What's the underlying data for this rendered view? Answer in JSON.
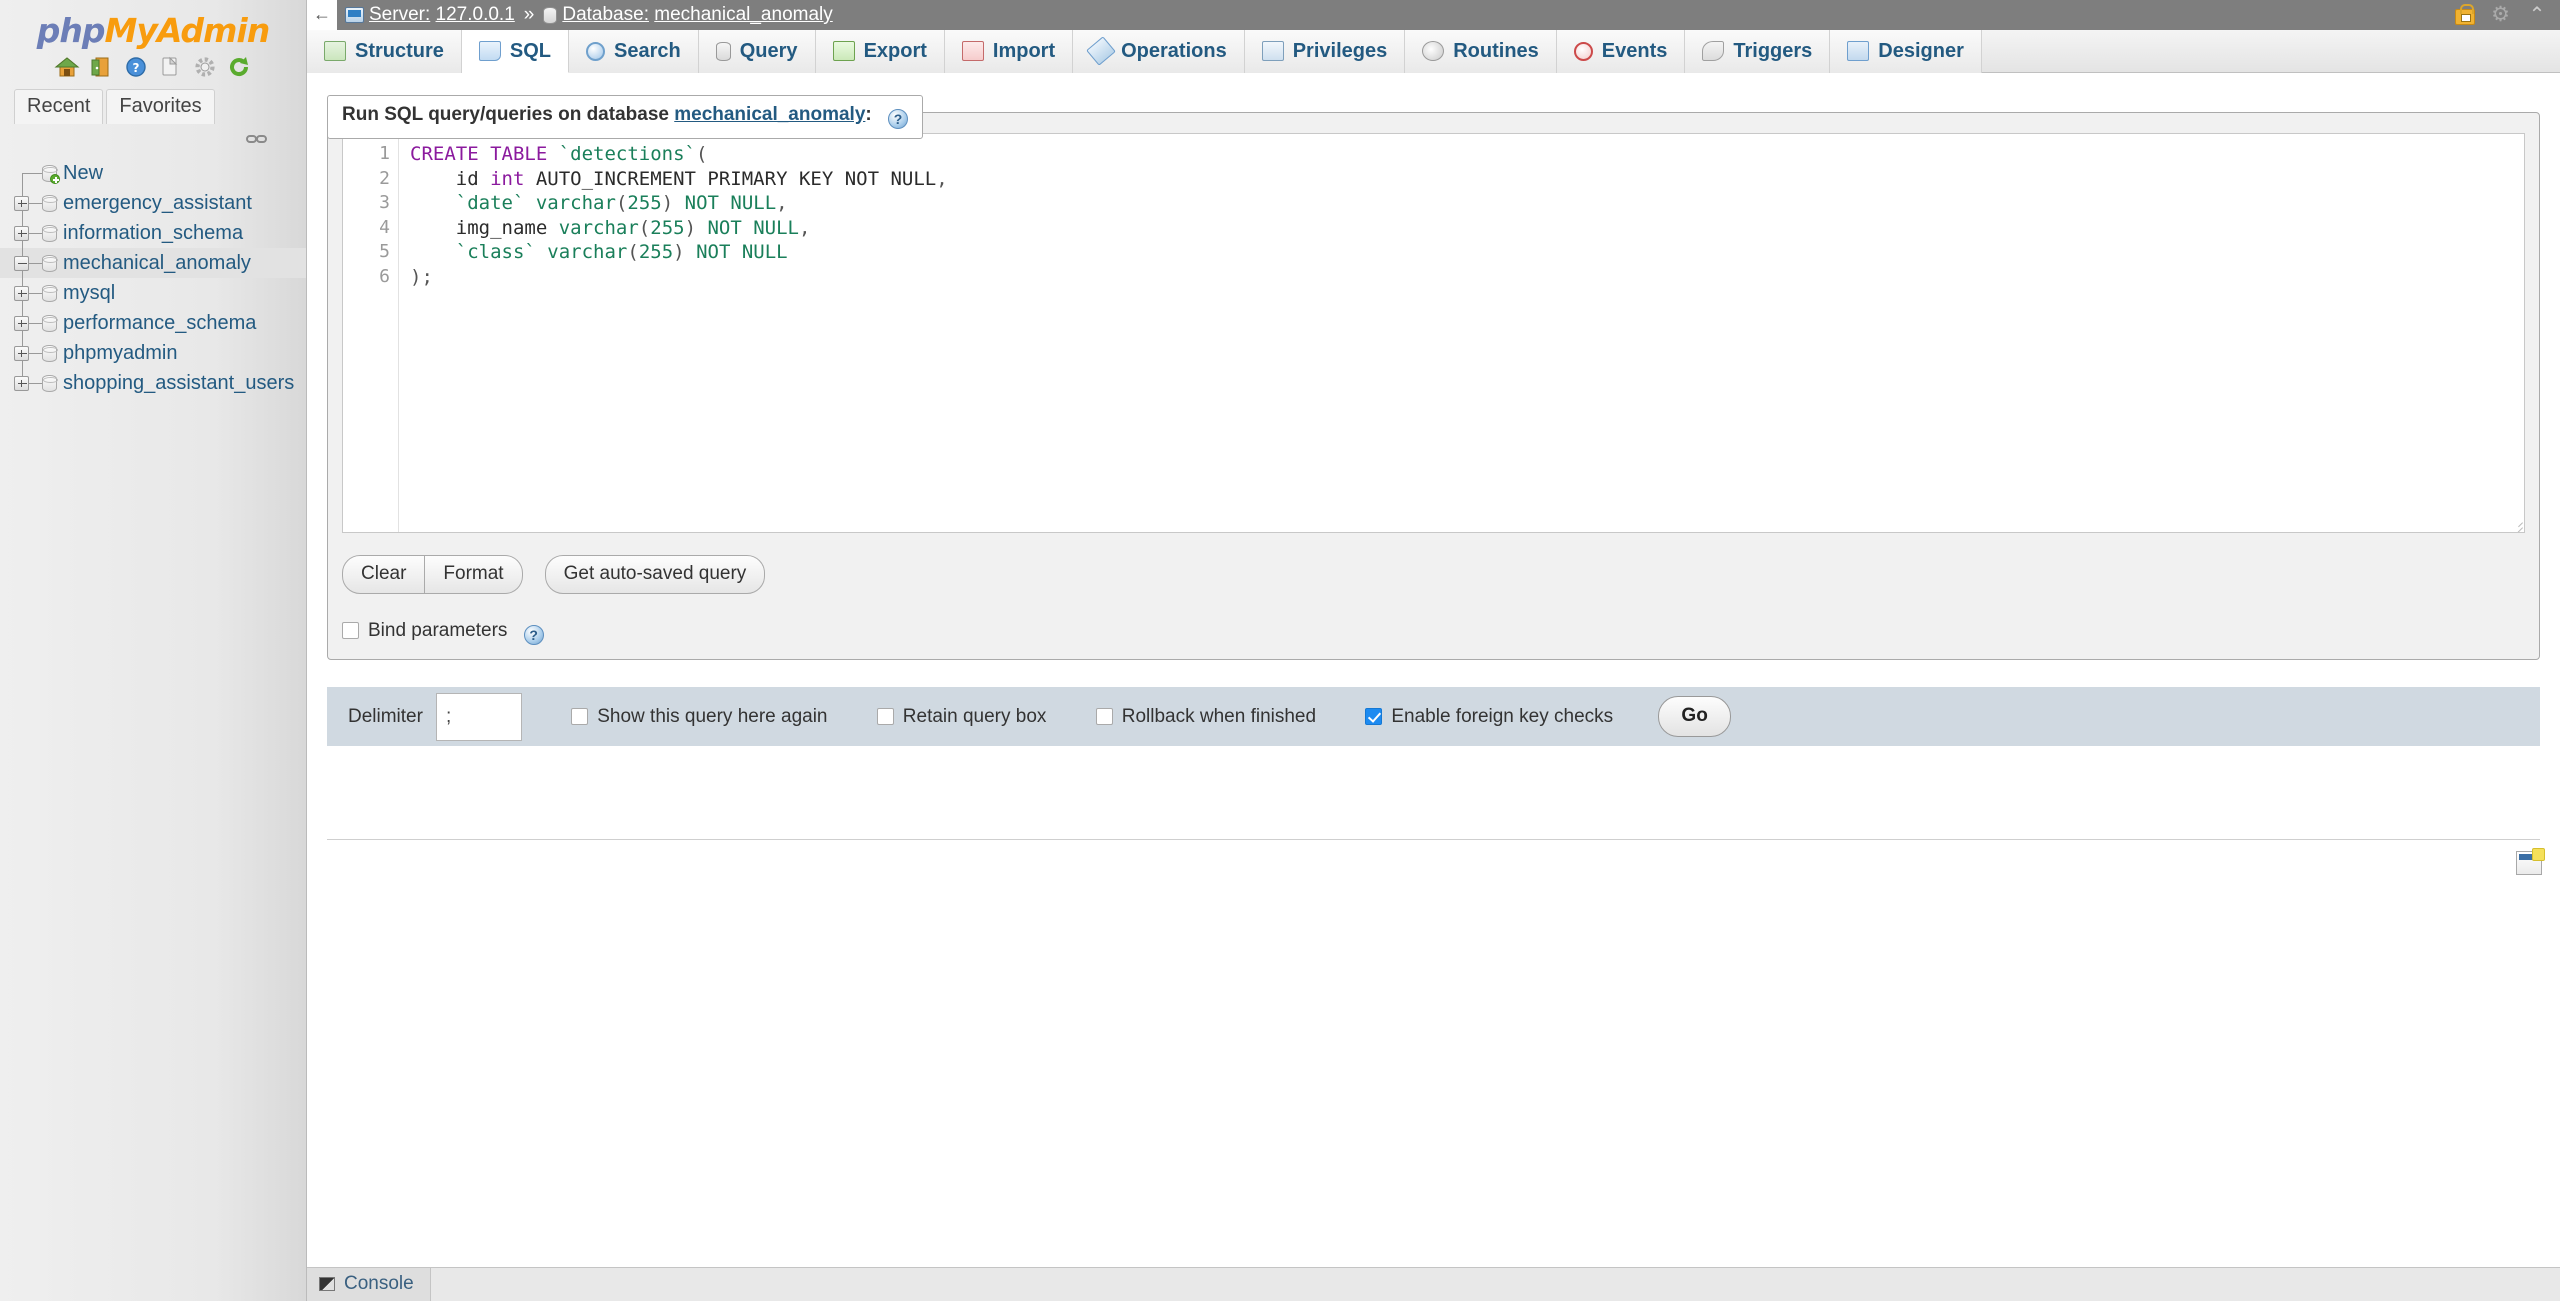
{
  "app": {
    "logo_php": "php",
    "logo_my": "My",
    "logo_admin": "Admin"
  },
  "navpanel": {
    "icons": [
      {
        "name": "home-icon"
      },
      {
        "name": "logout-icon"
      },
      {
        "name": "documentation-icon"
      },
      {
        "name": "copy-icon"
      },
      {
        "name": "settings-icon"
      },
      {
        "name": "reload-icon"
      }
    ],
    "tabs": [
      {
        "label": "Recent",
        "name": "nav-tab-recent"
      },
      {
        "label": "Favorites",
        "name": "nav-tab-favorites"
      }
    ],
    "chain_icon": "unlink-icon",
    "tree": [
      {
        "label": "New",
        "expander": "none",
        "selected": false,
        "new": true
      },
      {
        "label": "emergency_assistant",
        "expander": "plus",
        "selected": false
      },
      {
        "label": "information_schema",
        "expander": "plus",
        "selected": false
      },
      {
        "label": "mechanical_anomaly",
        "expander": "minus",
        "selected": true
      },
      {
        "label": "mysql",
        "expander": "plus",
        "selected": false
      },
      {
        "label": "performance_schema",
        "expander": "plus",
        "selected": false
      },
      {
        "label": "phpmyadmin",
        "expander": "plus",
        "selected": false
      },
      {
        "label": "shopping_assistant_users",
        "expander": "plus",
        "selected": false
      }
    ]
  },
  "topbar": {
    "back_arrow": "←",
    "server_label": "Server:",
    "server_value": "127.0.0.1",
    "separator": "»",
    "database_label": "Database:",
    "database_value": "mechanical_anomaly",
    "icons": [
      {
        "name": "lock-icon"
      },
      {
        "name": "gear-icon",
        "glyph": "⚙"
      },
      {
        "name": "collapse-icon",
        "glyph": "⌃"
      }
    ]
  },
  "tabs": [
    {
      "label": "Structure",
      "icon": "structure-icon",
      "cls": "ic-structure",
      "active": false
    },
    {
      "label": "SQL",
      "icon": "sql-icon",
      "cls": "ic-sql",
      "active": true
    },
    {
      "label": "Search",
      "icon": "search-icon",
      "cls": "ic-search",
      "active": false
    },
    {
      "label": "Query",
      "icon": "query-icon",
      "cls": "ic-query",
      "active": false
    },
    {
      "label": "Export",
      "icon": "export-icon",
      "cls": "ic-export",
      "active": false
    },
    {
      "label": "Import",
      "icon": "import-icon",
      "cls": "ic-import",
      "active": false
    },
    {
      "label": "Operations",
      "icon": "operations-icon",
      "cls": "ic-operations",
      "active": false
    },
    {
      "label": "Privileges",
      "icon": "privileges-icon",
      "cls": "ic-privileges",
      "active": false
    },
    {
      "label": "Routines",
      "icon": "routines-icon",
      "cls": "ic-routines",
      "active": false
    },
    {
      "label": "Events",
      "icon": "events-icon",
      "cls": "ic-events",
      "active": false
    },
    {
      "label": "Triggers",
      "icon": "triggers-icon",
      "cls": "ic-triggers",
      "active": false
    },
    {
      "label": "Designer",
      "icon": "designer-icon",
      "cls": "ic-designer",
      "active": false
    }
  ],
  "sql_form": {
    "legend_prefix": "Run SQL query/queries on database",
    "legend_db": "mechanical_anomaly",
    "legend_suffix": ":",
    "help_glyph": "?",
    "line_numbers": [
      "1",
      "2",
      "3",
      "4",
      "5",
      "6"
    ],
    "query_text": "CREATE TABLE `detections`(\n    id int AUTO_INCREMENT PRIMARY KEY NOT NULL,\n    `date` varchar(255) NOT NULL,\n    img_name varchar(255) NOT NULL,\n    `class` varchar(255) NOT NULL\n);",
    "query_lines": [
      [
        {
          "t": "CREATE TABLE ",
          "c": "tk-kw"
        },
        {
          "t": "`detections`",
          "c": "tk-ident"
        },
        {
          "t": "(",
          "c": "tk-punct"
        }
      ],
      [
        {
          "t": "    id ",
          "c": "tk-plain"
        },
        {
          "t": "int",
          "c": "tk-kw"
        },
        {
          "t": " AUTO_INCREMENT PRIMARY KEY NOT NULL",
          "c": "tk-plain"
        },
        {
          "t": ",",
          "c": "tk-punct"
        }
      ],
      [
        {
          "t": "    ",
          "c": "tk-plain"
        },
        {
          "t": "`date`",
          "c": "tk-ident"
        },
        {
          "t": " ",
          "c": "tk-plain"
        },
        {
          "t": "varchar",
          "c": "tk-type"
        },
        {
          "t": "(",
          "c": "tk-punct"
        },
        {
          "t": "255",
          "c": "tk-num"
        },
        {
          "t": ")",
          "c": "tk-punct"
        },
        {
          "t": " ",
          "c": "tk-plain"
        },
        {
          "t": "NOT NULL",
          "c": "tk-type"
        },
        {
          "t": ",",
          "c": "tk-punct"
        }
      ],
      [
        {
          "t": "    img_name ",
          "c": "tk-plain"
        },
        {
          "t": "varchar",
          "c": "tk-type"
        },
        {
          "t": "(",
          "c": "tk-punct"
        },
        {
          "t": "255",
          "c": "tk-num"
        },
        {
          "t": ")",
          "c": "tk-punct"
        },
        {
          "t": " ",
          "c": "tk-plain"
        },
        {
          "t": "NOT NULL",
          "c": "tk-type"
        },
        {
          "t": ",",
          "c": "tk-punct"
        }
      ],
      [
        {
          "t": "    ",
          "c": "tk-plain"
        },
        {
          "t": "`class`",
          "c": "tk-ident"
        },
        {
          "t": " ",
          "c": "tk-plain"
        },
        {
          "t": "varchar",
          "c": "tk-type"
        },
        {
          "t": "(",
          "c": "tk-punct"
        },
        {
          "t": "255",
          "c": "tk-num"
        },
        {
          "t": ")",
          "c": "tk-punct"
        },
        {
          "t": " ",
          "c": "tk-plain"
        },
        {
          "t": "NOT NULL",
          "c": "tk-type"
        }
      ],
      [
        {
          "t": ");",
          "c": "tk-punct"
        }
      ]
    ],
    "buttons": {
      "clear": "Clear",
      "format": "Format",
      "get_auto_saved": "Get auto-saved query"
    },
    "bind_parameters": {
      "label": "Bind parameters",
      "checked": false
    }
  },
  "footer": {
    "delimiter_label": "Delimiter",
    "delimiter_value": ";",
    "options": [
      {
        "label": "Show this query here again",
        "checked": false,
        "name": "show-query-again-checkbox"
      },
      {
        "label": "Retain query box",
        "checked": false,
        "name": "retain-query-box-checkbox"
      },
      {
        "label": "Rollback when finished",
        "checked": false,
        "name": "rollback-when-finished-checkbox"
      },
      {
        "label": "Enable foreign key checks",
        "checked": true,
        "name": "enable-foreign-key-checks-checkbox"
      }
    ],
    "go_label": "Go"
  },
  "console": {
    "label": "Console"
  },
  "colors": {
    "brand_blue": "#6c7eb7",
    "brand_orange": "#f89c0e",
    "link": "#235a81",
    "topbar_bg": "#7e7e7e",
    "checkbox_checked": "#1d8bf1",
    "footer_bg": "#d0d9e1"
  }
}
